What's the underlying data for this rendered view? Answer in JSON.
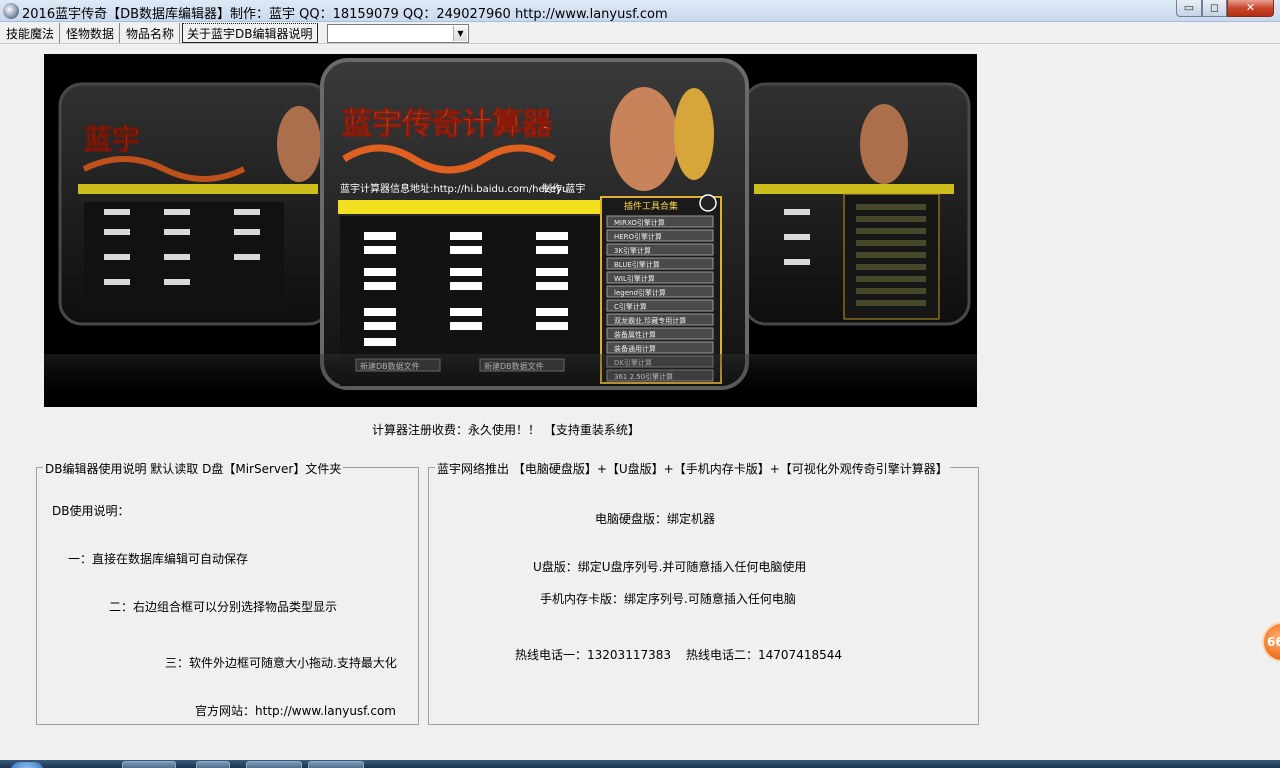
{
  "window": {
    "title": "2016蓝宇传奇【DB数据库编辑器】制作：蓝宇  QQ：18159079 QQ：249027960   http://www.lanyusf.com",
    "min_glyph": "▭",
    "max_glyph": "◻",
    "close_glyph": "✕"
  },
  "tabs": [
    {
      "label": "技能魔法"
    },
    {
      "label": "怪物数据"
    },
    {
      "label": "物品名称"
    },
    {
      "label": "关于蓝宇DB编辑器说明",
      "active": true
    }
  ],
  "combo": {
    "value": "",
    "arrow": "▼"
  },
  "banner": {
    "logo_text": "蓝宇传奇计算器",
    "url_text": "蓝宇计算器信息地址:http://hi.baidu.com/hezeyu",
    "author_text": "制作:蓝宇",
    "panel_title": "插件工具合集",
    "menu_items": [
      "MIRXO引擎计算",
      "HERO引擎计算",
      "3K引擎计算",
      "BLUE引擎计算",
      "WIL引擎计算",
      "legend引擎计算",
      "C引擎计算",
      "双龙霸业,珍藏专用计算",
      "装备属性计算",
      "装备通用计算",
      "DK引擎计算",
      "361 2.50引擎计算"
    ],
    "bottom_left": "新建DB数据文件",
    "bottom_right": "新建DB数据文件"
  },
  "registration_text": "计算器注册收费：永久使用！！ 【支持重装系统】",
  "usage_box": {
    "title": "DB编辑器使用说明    默认读取 D盘【MirServer】文件夹",
    "heading": "DB使用说明：",
    "item1": "一：直接在数据库编辑可自动保存",
    "item2": "二：右边组合框可以分别选择物品类型显示",
    "item3": "三：软件外边框可随意大小拖动.支持最大化",
    "site_label": "官方网站：",
    "site_url": "http://www.lanyusf.com"
  },
  "promo_box": {
    "title": "蓝宇网络推出 【电脑硬盘版】+【U盘版】+【手机内存卡版】+【可视化外观传奇引擎计算器】",
    "pc_version": "电脑硬盘版：绑定机器",
    "usb_version": "U盘版：绑定U盘序列号.并可随意插入任何电脑使用",
    "phone_version": "手机内存卡版：绑定序列号.可随意插入任何电脑",
    "hotline1_label": "热线电话一：",
    "hotline1": "13203117383",
    "hotline2_label": "热线电话二：",
    "hotline2": "14707418544"
  },
  "float_badge": "66",
  "colors": {
    "banner_bg": "#000000",
    "banner_gold": "#e0b030",
    "banner_panel": "#2a2a2a",
    "banner_yellow_bar": "#f2e020",
    "close_red": "#c8452c"
  }
}
